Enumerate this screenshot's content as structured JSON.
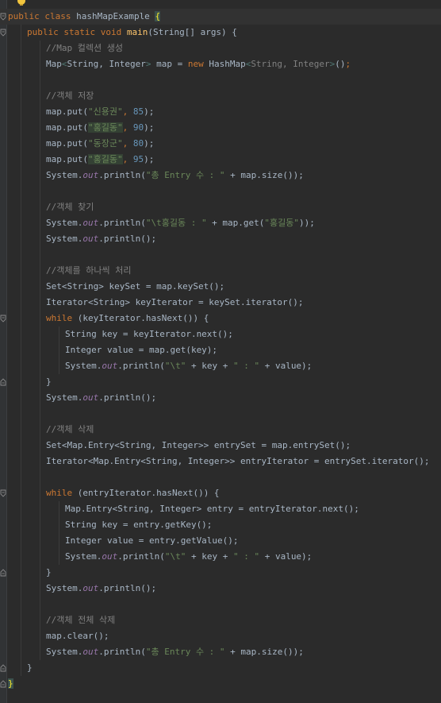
{
  "editor": {
    "lines": [
      [
        {
          "t": "public class ",
          "c": "kw"
        },
        {
          "t": "hashMapExample ",
          "c": ""
        },
        {
          "t": "{",
          "c": "brmatch"
        }
      ],
      [
        {
          "t": "public static void ",
          "c": "kw"
        },
        {
          "t": "main",
          "c": "fn"
        },
        {
          "t": "(String[] args) {",
          "c": ""
        }
      ],
      [
        {
          "t": "//Map 컬렉션 생성",
          "c": "cmt"
        }
      ],
      [
        {
          "t": "Map",
          "c": ""
        },
        {
          "t": "<",
          "c": "gen"
        },
        {
          "t": "String, Integer",
          "c": ""
        },
        {
          "t": ">",
          "c": "gen"
        },
        {
          "t": " map = ",
          "c": ""
        },
        {
          "t": "new ",
          "c": "kw"
        },
        {
          "t": "HashMap",
          "c": ""
        },
        {
          "t": "<",
          "c": "gen"
        },
        {
          "t": "String, Integer",
          "c": "cmt"
        },
        {
          "t": ">",
          "c": "gen"
        },
        {
          "t": "()",
          "c": ""
        },
        {
          "t": ";",
          "c": "kw"
        }
      ],
      [],
      [
        {
          "t": "//객체 저장",
          "c": "cmt"
        }
      ],
      [
        {
          "t": "map.put(",
          "c": ""
        },
        {
          "t": "\"신용권\"",
          "c": "str"
        },
        {
          "t": ", ",
          "c": "kw"
        },
        {
          "t": "85",
          "c": "num"
        },
        {
          "t": ");",
          "c": ""
        }
      ],
      [
        {
          "t": "map.put(",
          "c": ""
        },
        {
          "t": "\"홍길동\"",
          "c": "str hl"
        },
        {
          "t": ", ",
          "c": "kw"
        },
        {
          "t": "90",
          "c": "num"
        },
        {
          "t": ");",
          "c": ""
        }
      ],
      [
        {
          "t": "map.put(",
          "c": ""
        },
        {
          "t": "\"동장군\"",
          "c": "str"
        },
        {
          "t": ", ",
          "c": "kw"
        },
        {
          "t": "80",
          "c": "num"
        },
        {
          "t": ");",
          "c": ""
        }
      ],
      [
        {
          "t": "map.put(",
          "c": ""
        },
        {
          "t": "\"홍길동\"",
          "c": "str hl"
        },
        {
          "t": ", ",
          "c": "kw"
        },
        {
          "t": "95",
          "c": "num"
        },
        {
          "t": ");",
          "c": ""
        }
      ],
      [
        {
          "t": "System.",
          "c": ""
        },
        {
          "t": "out",
          "c": "st"
        },
        {
          "t": ".println(",
          "c": ""
        },
        {
          "t": "\"총 Entry 수 : \"",
          "c": "str"
        },
        {
          "t": " + map.size());",
          "c": ""
        }
      ],
      [],
      [
        {
          "t": "//객체 찾기",
          "c": "cmt"
        }
      ],
      [
        {
          "t": "System.",
          "c": ""
        },
        {
          "t": "out",
          "c": "st"
        },
        {
          "t": ".println(",
          "c": ""
        },
        {
          "t": "\"\\t홍길동 : \"",
          "c": "str"
        },
        {
          "t": " + map.get(",
          "c": ""
        },
        {
          "t": "\"홍길동\"",
          "c": "str"
        },
        {
          "t": "));",
          "c": ""
        }
      ],
      [
        {
          "t": "System.",
          "c": ""
        },
        {
          "t": "out",
          "c": "st"
        },
        {
          "t": ".println();",
          "c": ""
        }
      ],
      [],
      [
        {
          "t": "//객체를 하나씩 처리",
          "c": "cmt"
        }
      ],
      [
        {
          "t": "Set<String> keySet = map.keySet();",
          "c": ""
        }
      ],
      [
        {
          "t": "Iterator<String> keyIterator = keySet.iterator();",
          "c": ""
        }
      ],
      [
        {
          "t": "while ",
          "c": "kw"
        },
        {
          "t": "(keyIterator.hasNext()) {",
          "c": ""
        }
      ],
      [
        {
          "t": "String key = keyIterator.next();",
          "c": ""
        }
      ],
      [
        {
          "t": "Integer value = map.get(key);",
          "c": ""
        }
      ],
      [
        {
          "t": "System.",
          "c": ""
        },
        {
          "t": "out",
          "c": "st"
        },
        {
          "t": ".println(",
          "c": ""
        },
        {
          "t": "\"\\t\"",
          "c": "str"
        },
        {
          "t": " + key + ",
          "c": ""
        },
        {
          "t": "\" : \"",
          "c": "str"
        },
        {
          "t": " + value);",
          "c": ""
        }
      ],
      [
        {
          "t": "}",
          "c": ""
        }
      ],
      [
        {
          "t": "System.",
          "c": ""
        },
        {
          "t": "out",
          "c": "st"
        },
        {
          "t": ".println();",
          "c": ""
        }
      ],
      [],
      [
        {
          "t": "//객체 삭제",
          "c": "cmt"
        }
      ],
      [
        {
          "t": "Set<Map.Entry<String, Integer>> entrySet = map.entrySet();",
          "c": ""
        }
      ],
      [
        {
          "t": "Iterator<Map.Entry<String, Integer>> entryIterator = entrySet.iterator();",
          "c": ""
        }
      ],
      [],
      [
        {
          "t": "while ",
          "c": "kw"
        },
        {
          "t": "(entryIterator.hasNext()) {",
          "c": ""
        }
      ],
      [
        {
          "t": "Map.Entry<String, Integer> entry = entryIterator.next();",
          "c": ""
        }
      ],
      [
        {
          "t": "String key = entry.getKey();",
          "c": ""
        }
      ],
      [
        {
          "t": "Integer value = entry.getValue();",
          "c": ""
        }
      ],
      [
        {
          "t": "System.",
          "c": ""
        },
        {
          "t": "out",
          "c": "st"
        },
        {
          "t": ".println(",
          "c": ""
        },
        {
          "t": "\"\\t\"",
          "c": "str"
        },
        {
          "t": " + key + ",
          "c": ""
        },
        {
          "t": "\" : \"",
          "c": "str"
        },
        {
          "t": " + value);",
          "c": ""
        }
      ],
      [
        {
          "t": "}",
          "c": ""
        }
      ],
      [
        {
          "t": "System.",
          "c": ""
        },
        {
          "t": "out",
          "c": "st"
        },
        {
          "t": ".println();",
          "c": ""
        }
      ],
      [],
      [
        {
          "t": "//객체 전체 삭제",
          "c": "cmt"
        }
      ],
      [
        {
          "t": "map.clear();",
          "c": ""
        }
      ],
      [
        {
          "t": "System.",
          "c": ""
        },
        {
          "t": "out",
          "c": "st"
        },
        {
          "t": ".println(",
          "c": ""
        },
        {
          "t": "\"총 Entry 수 : \"",
          "c": "str"
        },
        {
          "t": " + map.size());",
          "c": ""
        }
      ],
      [
        {
          "t": "}",
          "c": ""
        }
      ],
      [
        {
          "t": "}",
          "c": "brmatch"
        }
      ]
    ]
  }
}
